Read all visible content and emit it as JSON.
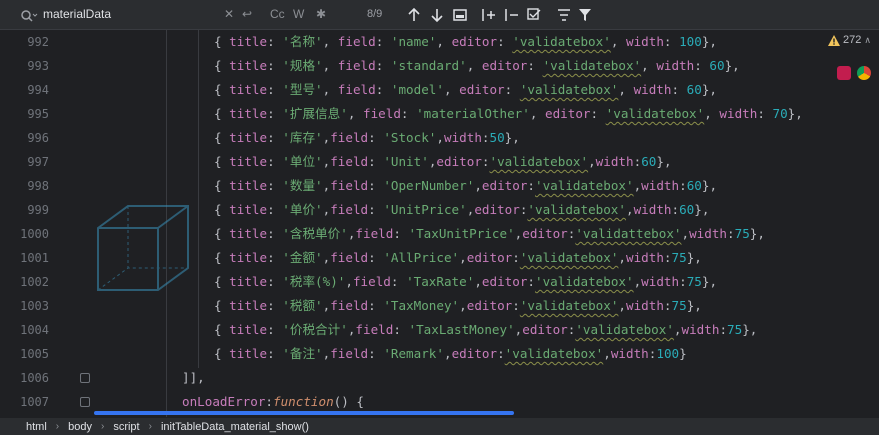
{
  "find": {
    "query": "materialData",
    "match_count": "8/9",
    "case_label": "Cc",
    "word_label": "W"
  },
  "editor": {
    "warning_count": "272",
    "lines": [
      {
        "no": "992",
        "title": "'名称'",
        "field": "'name'",
        "editor": "'validatebox'",
        "width": "100",
        "style": "spaced"
      },
      {
        "no": "993",
        "title": "'规格'",
        "field": "'standard'",
        "editor": "'validatebox'",
        "width": "60",
        "style": "spaced"
      },
      {
        "no": "994",
        "title": "'型号'",
        "field": "'model'",
        "editor": "'validatebox'",
        "width": "60",
        "style": "spaced"
      },
      {
        "no": "995",
        "title": "'扩展信息'",
        "field": "'materialOther'",
        "editor": "'validatebox'",
        "width": "70",
        "style": "spaced"
      },
      {
        "no": "996",
        "title": "'库存'",
        "field": "'Stock'",
        "editor": "",
        "width": "50",
        "style": "compact"
      },
      {
        "no": "997",
        "title": "'单位'",
        "field": "'Unit'",
        "editor": "'validatebox'",
        "width": "60",
        "style": "compact"
      },
      {
        "no": "998",
        "title": "'数量'",
        "field": "'OperNumber'",
        "editor": "'validatebox'",
        "width": "60",
        "style": "compact"
      },
      {
        "no": "999",
        "title": "'单价'",
        "field": "'UnitPrice'",
        "editor": "'validatebox'",
        "width": "60",
        "style": "compact"
      },
      {
        "no": "1000",
        "title": "'含税单价'",
        "field": "'TaxUnitPrice'",
        "editor": "'validattebox'",
        "width": "75",
        "style": "compact"
      },
      {
        "no": "1001",
        "title": "'金额'",
        "field": "'AllPrice'",
        "editor": "'validatebox'",
        "width": "75",
        "style": "compact"
      },
      {
        "no": "1002",
        "title": "'税率(%)'",
        "field": "'TaxRate'",
        "editor": "'validatebox'",
        "width": "75",
        "style": "compact"
      },
      {
        "no": "1003",
        "title": "'税额'",
        "field": "'TaxMoney'",
        "editor": "'validatebox'",
        "width": "75",
        "style": "compact"
      },
      {
        "no": "1004",
        "title": "'价税合计'",
        "field": "'TaxLastMoney'",
        "editor": "'validatebox'",
        "width": "75",
        "style": "compact"
      },
      {
        "no": "1005",
        "title": "'备注'",
        "field": "'Remark'",
        "editor": "'validatebox'",
        "width": "100",
        "style": "compact"
      }
    ],
    "line_1006": {
      "no": "1006",
      "text": "]],"
    },
    "line_1007": {
      "no": "1007",
      "key": "onLoadError",
      "kw": "function",
      "rest": "() {"
    }
  },
  "breadcrumb": [
    "html",
    "body",
    "script",
    "initTableData_material_show()"
  ],
  "colors": {
    "background": "#1f2023",
    "string": "#6aab73",
    "property": "#c77dbb",
    "number": "#2aacb8",
    "keyword": "#cf8e6d",
    "accent": "#3574f0"
  },
  "icons": [
    "search-icon",
    "replace-icon",
    "regex-icon",
    "arrow-up-icon",
    "arrow-down-icon",
    "filter-icon",
    "warning-icon"
  ]
}
